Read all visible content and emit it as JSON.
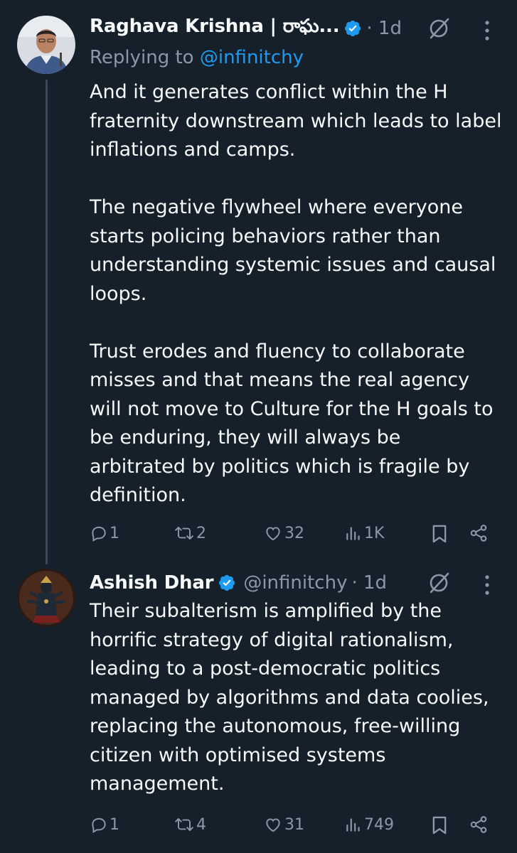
{
  "colors": {
    "background": "#15202b",
    "text": "#f7f9f9",
    "muted": "#8b98a5",
    "accent": "#1d9bf0",
    "thread_line": "#3b4a59"
  },
  "tweets": [
    {
      "author_name": "Raghava Krishna | రాఘ...",
      "verified": true,
      "handle": "",
      "time": "· 1d",
      "replying_prefix": "Replying to ",
      "replying_to": "@infinitchy",
      "paragraphs": [
        "And it generates conflict within the H fraternity downstream which leads to label inflations and camps.",
        "The negative flywheel where everyone starts policing behaviors rather than understanding systemic issues and causal loops.",
        "Trust erodes and fluency to collaborate misses and that means the real agency will not move to Culture for the H goals to be enduring, they will always be arbitrated by politics which is fragile by definition."
      ],
      "replies": "1",
      "retweets": "2",
      "likes": "32",
      "views": "1K",
      "icons": [
        "reply-icon",
        "retweet-icon",
        "like-icon",
        "views-icon",
        "bookmark-icon",
        "share-icon"
      ]
    },
    {
      "author_name": "Ashish Dhar",
      "verified": true,
      "handle": "@infinitchy",
      "time": "· 1d",
      "paragraphs": [
        "Their subalterism is amplified by the horrific strategy of digital rationalism, leading to a post-democratic politics managed by algorithms and data coolies, replacing the autonomous, free-willing citizen with optimised systems management."
      ],
      "replies": "1",
      "retweets": "4",
      "likes": "31",
      "views": "749",
      "icons": [
        "reply-icon",
        "retweet-icon",
        "like-icon",
        "views-icon",
        "bookmark-icon",
        "share-icon"
      ]
    }
  ]
}
